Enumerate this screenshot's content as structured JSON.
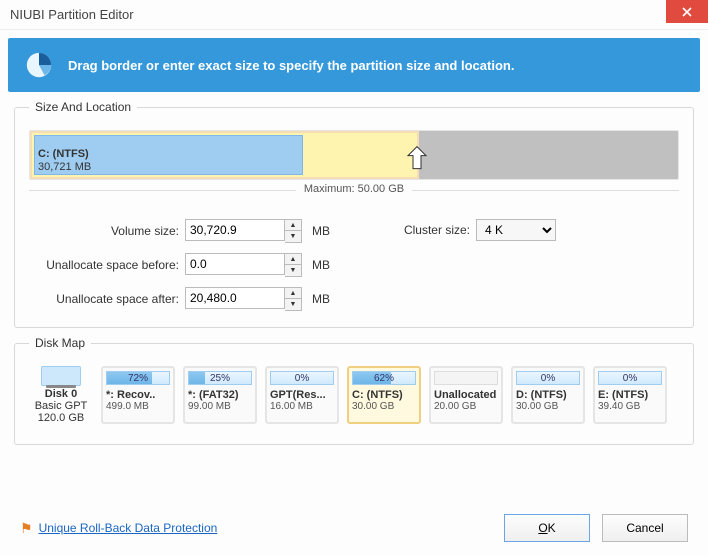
{
  "title": "NIUBI Partition Editor",
  "banner": {
    "text": "Drag border or enter exact size to specify the partition size and location."
  },
  "group_size": {
    "legend": "Size And Location",
    "partition_label": "C: (NTFS)",
    "partition_size": "30,721 MB",
    "used_width_pct": 60,
    "data_width_pct": 70,
    "maximum": "Maximum: 50.00 GB"
  },
  "form": {
    "volume_size": {
      "label": "Volume size:",
      "value": "30,720.9",
      "unit": "MB"
    },
    "unalloc_before": {
      "label": "Unallocate space before:",
      "value": "0.0",
      "unit": "MB"
    },
    "unalloc_after": {
      "label": "Unallocate space after:",
      "value": "20,480.0",
      "unit": "MB"
    },
    "cluster_size": {
      "label": "Cluster size:",
      "value": "4 K"
    }
  },
  "group_map": {
    "legend": "Disk Map",
    "disk": {
      "name": "Disk 0",
      "type": "Basic GPT",
      "size": "120.0 GB"
    },
    "parts": [
      {
        "pct": "72%",
        "fill": 72,
        "name": "*: Recov..",
        "size": "499.0 MB",
        "selected": false
      },
      {
        "pct": "25%",
        "fill": 25,
        "name": "*: (FAT32)",
        "size": "99.00 MB",
        "selected": false
      },
      {
        "pct": "0%",
        "fill": 0,
        "name": "GPT(Res...",
        "size": "16.00 MB",
        "selected": false
      },
      {
        "pct": "62%",
        "fill": 62,
        "name": "C: (NTFS)",
        "size": "30.00 GB",
        "selected": true
      },
      {
        "pct": "",
        "fill": 0,
        "name": "Unallocated",
        "size": "20.00 GB",
        "selected": false,
        "unalloc": true
      },
      {
        "pct": "0%",
        "fill": 0,
        "name": "D: (NTFS)",
        "size": "30.00 GB",
        "selected": false
      },
      {
        "pct": "0%",
        "fill": 0,
        "name": "E: (NTFS)",
        "size": "39.40 GB",
        "selected": false
      }
    ]
  },
  "footer": {
    "link": "Unique Roll-Back Data Protection",
    "ok": "OK",
    "cancel": "Cancel"
  }
}
